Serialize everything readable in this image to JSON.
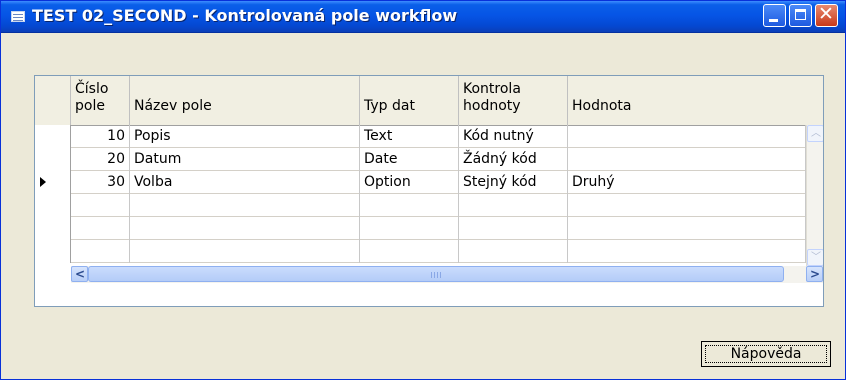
{
  "window": {
    "title": "TEST 02_SECOND - Kontrolovaná pole workflow"
  },
  "title_controls": {
    "minimize": "minimize-icon",
    "maximize": "maximize-icon",
    "close": "close-icon",
    "close_glyph": "✕"
  },
  "table": {
    "headers": [
      "Číslo pole",
      "Název pole",
      "Typ dat",
      "Kontrola hodnoty",
      "Hodnota"
    ],
    "rows": [
      {
        "cislo": "10",
        "nazev": "Popis",
        "typ": "Text",
        "kontrola": "Kód nutný",
        "hodnota": ""
      },
      {
        "cislo": "20",
        "nazev": "Datum",
        "typ": "Date",
        "kontrola": "Žádný kód",
        "hodnota": ""
      },
      {
        "cislo": "30",
        "nazev": "Volba",
        "typ": "Option",
        "kontrola": "Stejný kód",
        "hodnota": "Druhý"
      },
      {
        "cislo": "",
        "nazev": "",
        "typ": "",
        "kontrola": "",
        "hodnota": ""
      },
      {
        "cislo": "",
        "nazev": "",
        "typ": "",
        "kontrola": "",
        "hodnota": ""
      },
      {
        "cislo": "",
        "nazev": "",
        "typ": "",
        "kontrola": "",
        "hodnota": ""
      }
    ],
    "current_row": 3
  },
  "buttons": {
    "help": "Nápověda"
  }
}
